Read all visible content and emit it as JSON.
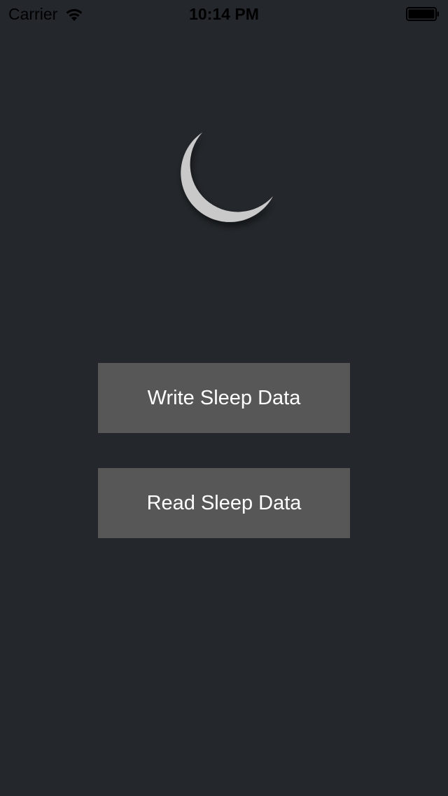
{
  "status_bar": {
    "carrier": "Carrier",
    "time": "10:14 PM",
    "wifi_icon": "wifi-icon",
    "battery_icon": "battery-icon"
  },
  "main": {
    "moon_icon": "moon-icon",
    "write_button_label": "Write Sleep Data",
    "read_button_label": "Read Sleep Data"
  },
  "colors": {
    "background": "#24282c",
    "button": "#575757",
    "button_text": "#ffffff",
    "moon": "#dcdcdc"
  }
}
